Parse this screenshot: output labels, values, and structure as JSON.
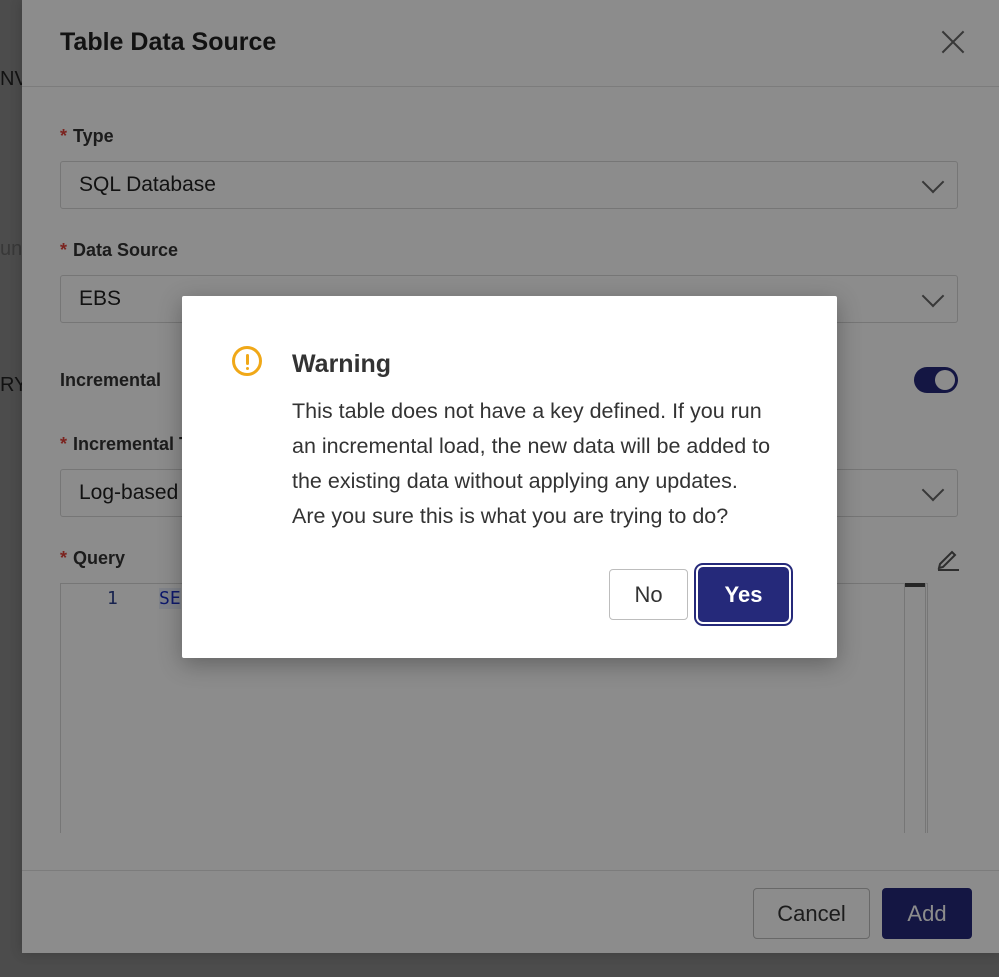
{
  "background": {
    "fragments": [
      "NV",
      "un",
      "RY"
    ]
  },
  "dialog": {
    "title": "Table Data Source",
    "fields": {
      "type": {
        "label": "Type",
        "required_mark": "*",
        "value": "SQL Database"
      },
      "data_source": {
        "label": "Data Source",
        "required_mark": "*",
        "value": "EBS"
      },
      "incremental": {
        "label": "Incremental",
        "enabled": true
      },
      "incremental_type": {
        "label": "Incremental T",
        "required_mark": "*",
        "value": "Log-based"
      },
      "query": {
        "label": "Query",
        "required_mark": "*",
        "line_number": "1",
        "code": "SE"
      }
    },
    "footer": {
      "cancel_label": "Cancel",
      "add_label": "Add"
    }
  },
  "warning_modal": {
    "title": "Warning",
    "message_lines": [
      "This table does not have a key defined. If you run",
      "an incremental load, the new data will be added to",
      "the existing data without applying any updates.",
      "Are you sure this is what you are trying to do?"
    ],
    "no_label": "No",
    "yes_label": "Yes"
  },
  "colors": {
    "accent": "#25297a",
    "warning": "#f0a818",
    "required": "#e0413a"
  }
}
